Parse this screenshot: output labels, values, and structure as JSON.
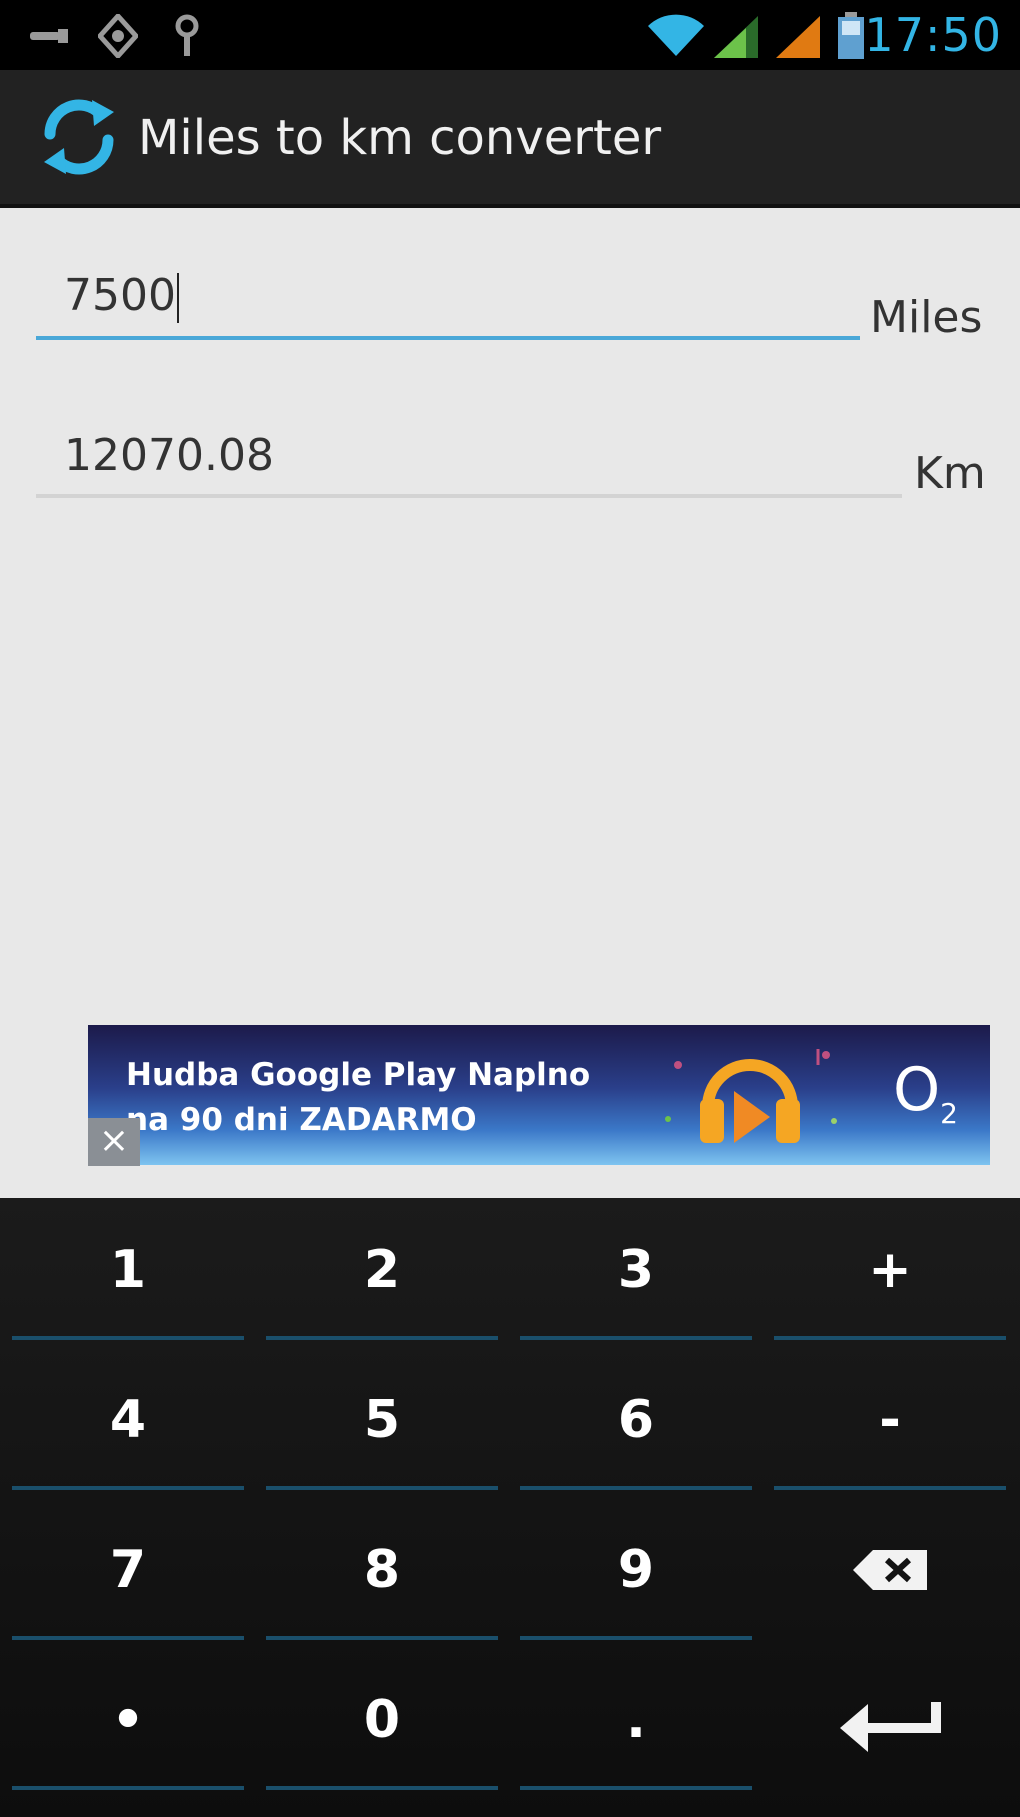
{
  "status_bar": {
    "time": "17:50",
    "icons": [
      "usb-icon",
      "android-debug-icon",
      "location-icon",
      "wifi-icon",
      "signal-green-icon",
      "signal-orange-icon",
      "battery-icon"
    ],
    "accent": "#33b5e5"
  },
  "action_bar": {
    "title": "Miles to km converter",
    "icon": "sync-icon"
  },
  "converter": {
    "miles_value": "7500",
    "miles_unit": "Miles",
    "km_value": "12070.08",
    "km_unit": "Km"
  },
  "ad": {
    "line1": "Hudba Google Play Naplno",
    "line2": "na 90 dni ZADARMO",
    "brand": "O",
    "brand_sub": "2",
    "close_label": "×"
  },
  "keypad": {
    "keys": [
      {
        "label": "1"
      },
      {
        "label": "2"
      },
      {
        "label": "3"
      },
      {
        "label": "+"
      },
      {
        "label": "4"
      },
      {
        "label": "5"
      },
      {
        "label": "6"
      },
      {
        "label": "-"
      },
      {
        "label": "7"
      },
      {
        "label": "8"
      },
      {
        "label": "9"
      },
      {
        "label": "",
        "icon": "backspace-icon"
      },
      {
        "label": "•"
      },
      {
        "label": "0"
      },
      {
        "label": "."
      },
      {
        "label": "",
        "icon": "enter-icon"
      }
    ]
  }
}
